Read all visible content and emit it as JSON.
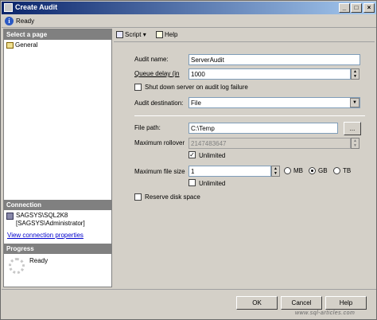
{
  "window": {
    "title": "Create Audit",
    "controls": {
      "minimize": "_",
      "maximize": "□",
      "close": "×"
    }
  },
  "status_strip": {
    "text": "Ready",
    "icon": "info-icon"
  },
  "left_pane": {
    "select_page_header": "Select a page",
    "pages": [
      {
        "label": "General"
      }
    ],
    "connection_header": "Connection",
    "server": "SAGSYS\\SQL2K8",
    "user": "[SAGSYS\\Administrator]",
    "view_props_link": "View connection properties",
    "progress_header": "Progress",
    "progress_text": "Ready"
  },
  "toolbar": {
    "script_label": "Script",
    "script_dropdown": "▾",
    "help_label": "Help"
  },
  "form": {
    "audit_name_label": "Audit name:",
    "audit_name_value": "ServerAudit",
    "queue_delay_label": "Queue delay (in",
    "queue_delay_value": "1000",
    "shutdown_label": "Shut down server on audit log failure",
    "shutdown_checked": false,
    "audit_dest_label": "Audit destination:",
    "audit_dest_value": "File",
    "file_path_label": "File path:",
    "file_path_value": "C:\\Temp",
    "browse_label": "...",
    "max_rollover_label": "Maximum rollover",
    "max_rollover_value": "2147483647",
    "unlimited_rollover_label": "Unlimited",
    "unlimited_rollover_checked": true,
    "max_file_size_label": "Maximum file size",
    "max_file_size_value": "1",
    "unit_mb": "MB",
    "unit_gb": "GB",
    "unit_tb": "TB",
    "selected_unit": "GB",
    "unlimited_size_label": "Unlimited",
    "unlimited_size_checked": false,
    "reserve_label": "Reserve disk space",
    "reserve_checked": false
  },
  "buttons": {
    "ok": "OK",
    "cancel": "Cancel",
    "help": "Help"
  },
  "watermark": "www.sql-articles.com"
}
